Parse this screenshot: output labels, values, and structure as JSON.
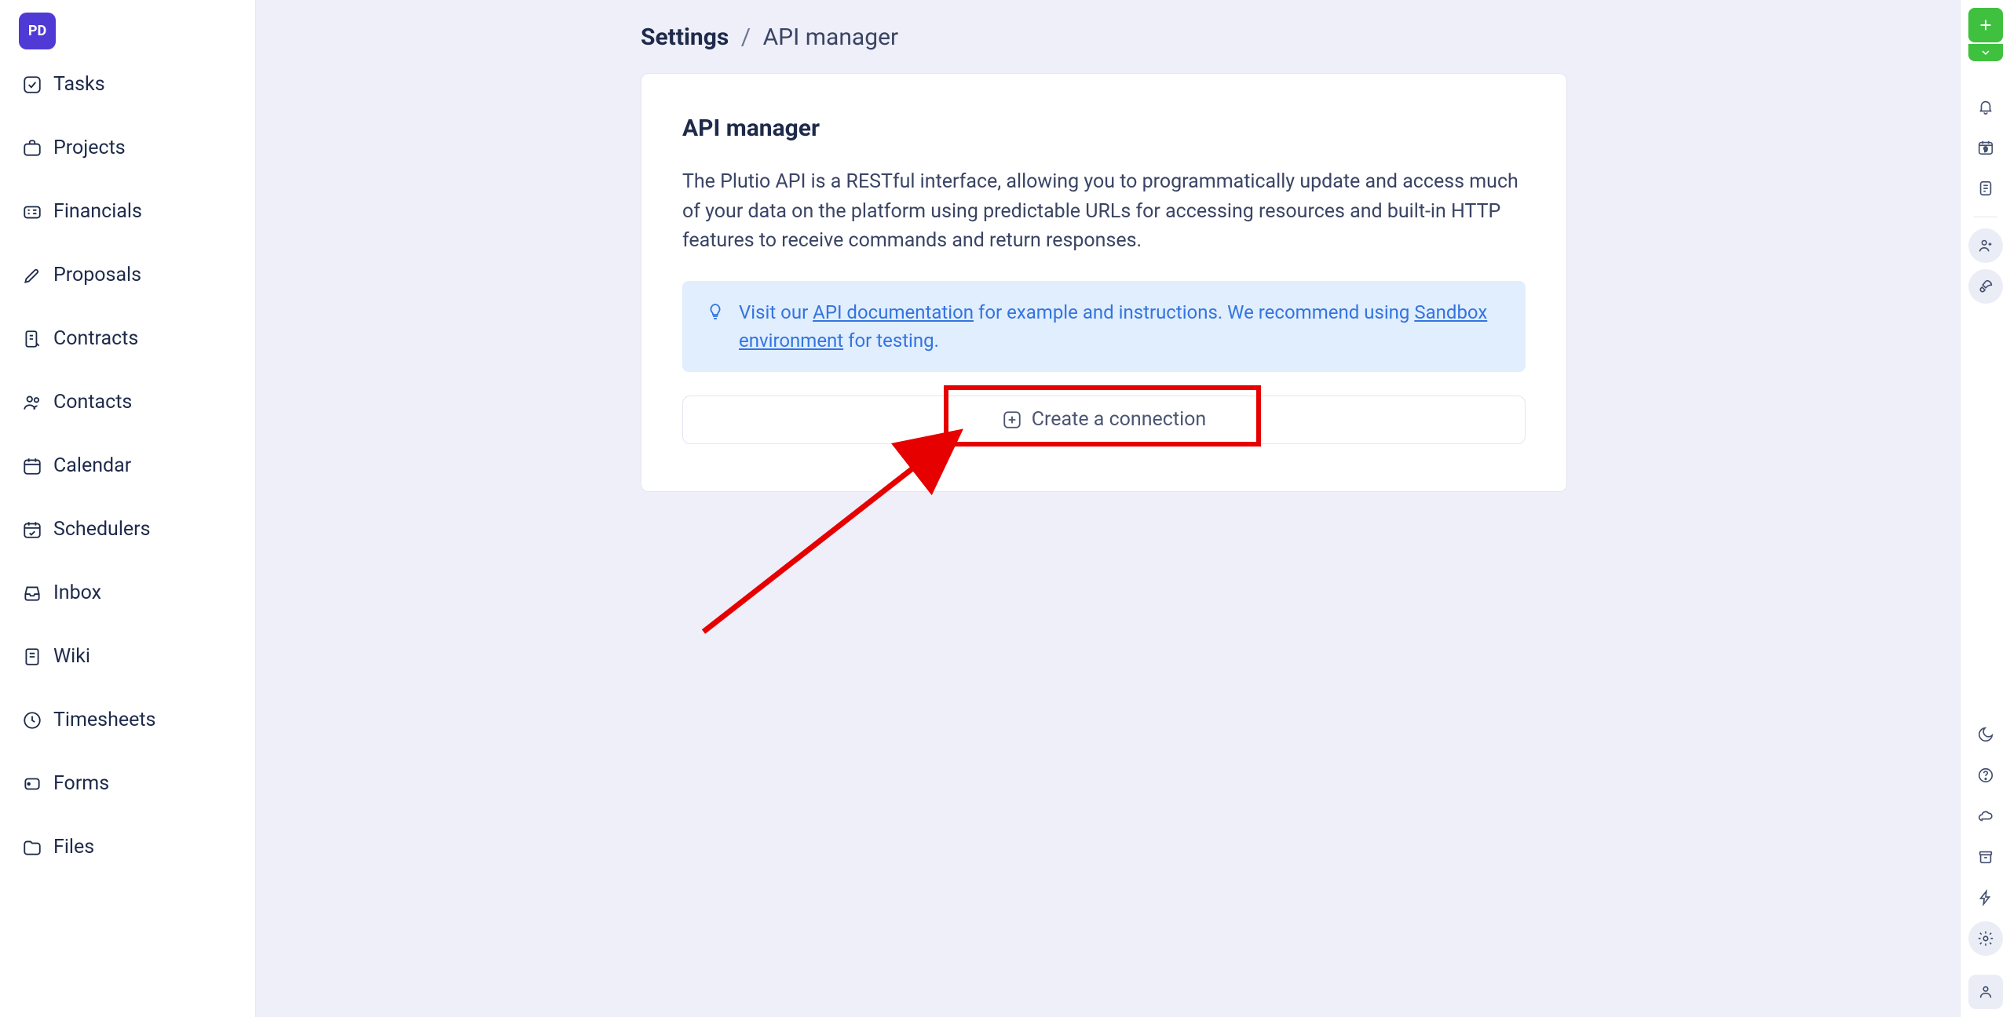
{
  "avatar": {
    "initials": "PD"
  },
  "sidebar": {
    "items": [
      {
        "label": "Tasks"
      },
      {
        "label": "Projects"
      },
      {
        "label": "Financials"
      },
      {
        "label": "Proposals"
      },
      {
        "label": "Contracts"
      },
      {
        "label": "Contacts"
      },
      {
        "label": "Calendar"
      },
      {
        "label": "Schedulers"
      },
      {
        "label": "Inbox"
      },
      {
        "label": "Wiki"
      },
      {
        "label": "Timesheets"
      },
      {
        "label": "Forms"
      },
      {
        "label": "Files"
      }
    ]
  },
  "breadcrumb": {
    "part1": "Settings",
    "sep": "/",
    "part2": "API manager"
  },
  "card": {
    "title": "API manager",
    "description": "The Plutio API is a RESTful interface, allowing you to programmatically update and access much of your data on the platform using predictable URLs for accessing resources and built-in HTTP features to receive commands and return responses.",
    "info_prefix": "Visit our ",
    "info_link1": "API documentation",
    "info_mid": " for example and instructions. We recommend using ",
    "info_link2": "Sandbox environment",
    "info_suffix": " for testing.",
    "create_label": "Create a connection"
  },
  "rightbar": {
    "calendar_day": "9"
  }
}
